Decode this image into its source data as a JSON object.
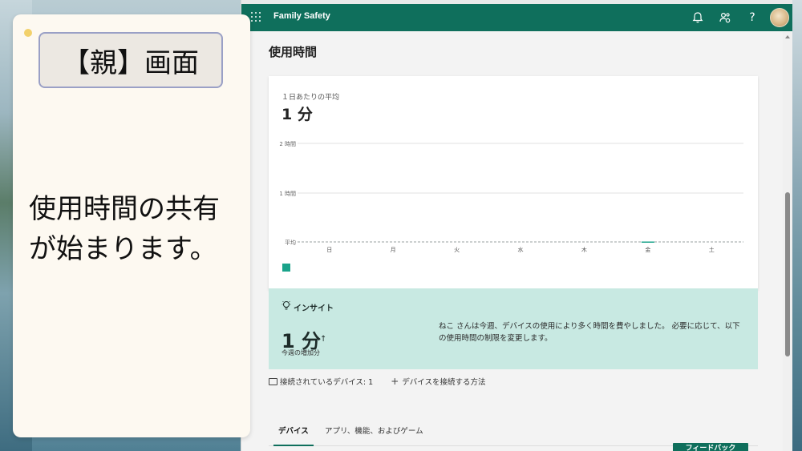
{
  "app": {
    "brand": "Family Safety"
  },
  "page": {
    "title": "使用時間"
  },
  "summary": {
    "avg_label": "１日あたりの平均",
    "avg_value": "1 分"
  },
  "chart_data": {
    "type": "bar",
    "categories": [
      "日",
      "月",
      "火",
      "水",
      "木",
      "金",
      "土"
    ],
    "series": [
      {
        "values": [
          0,
          0,
          0,
          0,
          0,
          1,
          0
        ]
      }
    ],
    "y_tick_labels": [
      "2 時間",
      "1 時間",
      "平均"
    ],
    "ylim_minutes": [
      0,
      120
    ],
    "average_minutes": 1,
    "grid": true,
    "colors": {
      "bar": "#1aa38a",
      "average_line": "#9aa0a0"
    }
  },
  "insight": {
    "heading": "インサイト",
    "value": "1 分",
    "arrow": "↑",
    "sub": "今週の増加分",
    "message": "ねこ さんは今週、デバイスの使用により多く時間を費やしました。 必要に応じて、以下の使用時間の制限を変更します。"
  },
  "devices": {
    "connected": "接続されているデバイス: 1",
    "how_to": "デバイスを接続する方法"
  },
  "tabs": [
    {
      "label": "デバイス",
      "active": true
    },
    {
      "label": "アプリ、機能、およびゲーム",
      "active": false
    }
  ],
  "feedback": "フィードバック",
  "overlay": {
    "label": "【親】画面",
    "caption": "使用時間の共有\nが始まります。"
  },
  "colors": {
    "brand": "#0f6f5c",
    "insight_bg": "#c8e9e2",
    "accent": "#1aa38a"
  }
}
